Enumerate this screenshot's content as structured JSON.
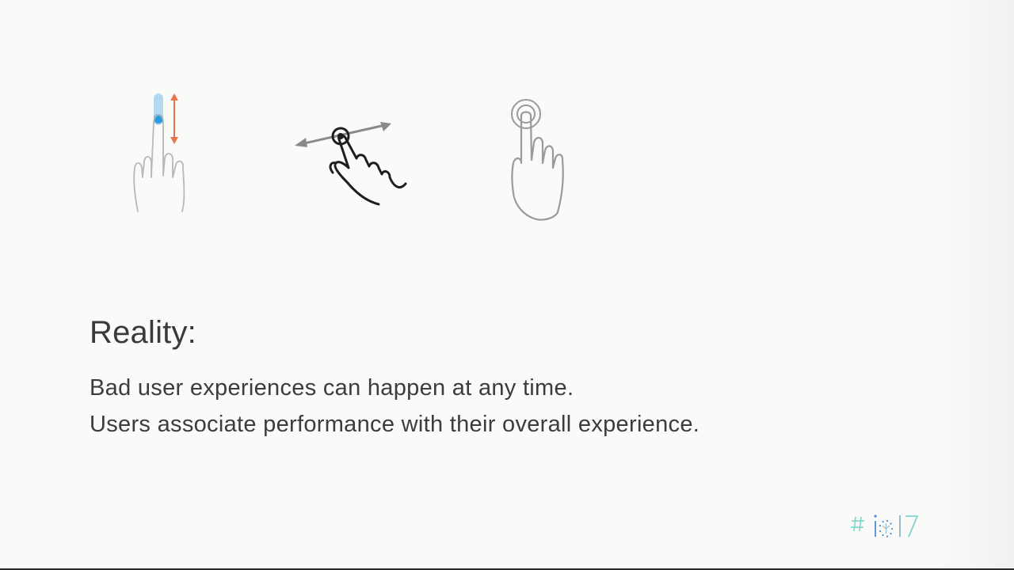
{
  "slide": {
    "heading": "Reality:",
    "lines": [
      "Bad user experiences can happen at any time.",
      "Users associate performance with their overall experience."
    ]
  },
  "icons": {
    "scroll_gesture": "vertical-scroll-gesture-icon",
    "swipe_gesture": "horizontal-swipe-gesture-icon",
    "tap_gesture": "tap-gesture-icon",
    "logo": "google-io-17-logo"
  },
  "logo_text": "#io17",
  "colors": {
    "background": "#fafaf8",
    "text": "#3c3c3c",
    "scroll_finger_blue": "#2b9be0",
    "scroll_arrow_orange": "#e8744a",
    "swipe_arrow_gray": "#8a8a8a",
    "tap_gray": "#9a9a9a",
    "logo_teal": "#7fd6c9",
    "logo_blue": "#4a8fd8",
    "logo_gray": "#8ab4c8"
  }
}
